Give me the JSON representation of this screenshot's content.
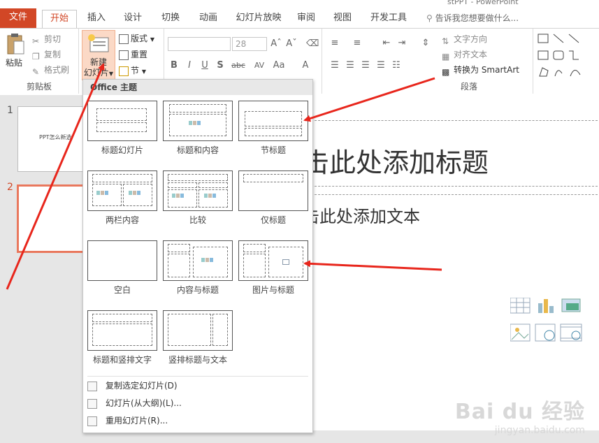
{
  "window": {
    "title_fragment": "stPPT - PowerPoint"
  },
  "tabs": [
    {
      "label": "文件"
    },
    {
      "label": "开始"
    },
    {
      "label": "插入"
    },
    {
      "label": "设计"
    },
    {
      "label": "切换"
    },
    {
      "label": "动画"
    },
    {
      "label": "幻灯片放映"
    },
    {
      "label": "审阅"
    },
    {
      "label": "视图"
    },
    {
      "label": "开发工具"
    }
  ],
  "tell_me": {
    "placeholder": "告诉我您想要做什么..."
  },
  "ribbon": {
    "clipboard": {
      "paste": "粘贴",
      "cut": "剪切",
      "copy": "复制",
      "format_painter": "格式刷",
      "group_label": "剪贴板"
    },
    "slides": {
      "new_slide_line1": "新建",
      "new_slide_line2": "幻灯片",
      "layout": "版式",
      "reset": "重置",
      "section": "节"
    },
    "font": {
      "size": "28",
      "bold": "B",
      "italic": "I",
      "underline": "U",
      "shadow": "S",
      "strike": "abc",
      "spacing": "AV",
      "case": "Aa",
      "color": "A"
    },
    "paragraph": {
      "text_direction": "文字方向",
      "align_text": "对齐文本",
      "smartart": "转换为 SmartArt",
      "group_label": "段落"
    }
  },
  "thumbnails": [
    {
      "number": "1",
      "text": "PPT怎么新选"
    },
    {
      "number": "2",
      "text": ""
    }
  ],
  "slide": {
    "title_placeholder": "击此处添加标题",
    "text_placeholder": "击此处添加文本"
  },
  "dropdown": {
    "header": "Office 主题",
    "layouts": [
      {
        "label": "标题幻灯片"
      },
      {
        "label": "标题和内容"
      },
      {
        "label": "节标题"
      },
      {
        "label": "两栏内容"
      },
      {
        "label": "比较"
      },
      {
        "label": "仅标题"
      },
      {
        "label": "空白"
      },
      {
        "label": "内容与标题"
      },
      {
        "label": "图片与标题"
      },
      {
        "label": "标题和竖排文字"
      },
      {
        "label": "竖排标题与文本"
      }
    ],
    "menu": [
      {
        "label": "复制选定幻灯片(D)"
      },
      {
        "label": "幻灯片(从大纲)(L)..."
      },
      {
        "label": "重用幻灯片(R)..."
      }
    ]
  },
  "watermark": {
    "brand": "Bai du 经验",
    "url": "jingyan.baidu.com"
  },
  "colors": {
    "accent": "#d24726",
    "arrow": "#e8261c",
    "selection": "#f4b183"
  }
}
